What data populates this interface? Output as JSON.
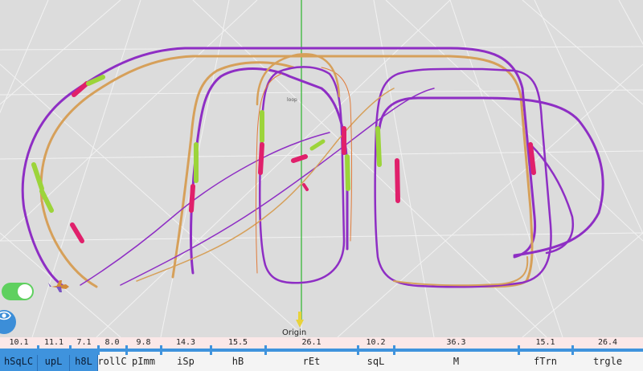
{
  "scene": {
    "origin_label": "Origin",
    "small_label": "loop"
  },
  "colors": {
    "background": "#dcdcdc",
    "path_purple": "#8e2ec4",
    "path_orange": "#d6a05a",
    "path_pink": "#e0206b",
    "path_green": "#9cd43a",
    "axis_green": "#2bb32b",
    "accent_blue": "#3f93dd",
    "toggle_green": "#5fd05f"
  },
  "controls": {
    "toggle_on": true,
    "toggle_icon": "toggle-switch-icon",
    "view_icon": "eye-icon"
  },
  "timeline": {
    "segments": [
      {
        "label": "hSqLC",
        "value": "10.1",
        "active": true
      },
      {
        "label": "upL",
        "value": "11.1",
        "active": true
      },
      {
        "label": "h8L",
        "value": "7.1",
        "active": true
      },
      {
        "label": "rollC",
        "value": "8.0",
        "active": false
      },
      {
        "label": "pImm",
        "value": "9.8",
        "active": false
      },
      {
        "label": "iSp",
        "value": "14.3",
        "active": false
      },
      {
        "label": "hB",
        "value": "15.5",
        "active": false
      },
      {
        "label": "rEt",
        "value": "26.1",
        "active": false
      },
      {
        "label": "sqL",
        "value": "10.2",
        "active": false
      },
      {
        "label": "M",
        "value": "36.3",
        "active": false
      },
      {
        "label": "fTrn",
        "value": "15.1",
        "active": false
      },
      {
        "label": "trgle",
        "value": "26.4",
        "active": false
      }
    ]
  }
}
